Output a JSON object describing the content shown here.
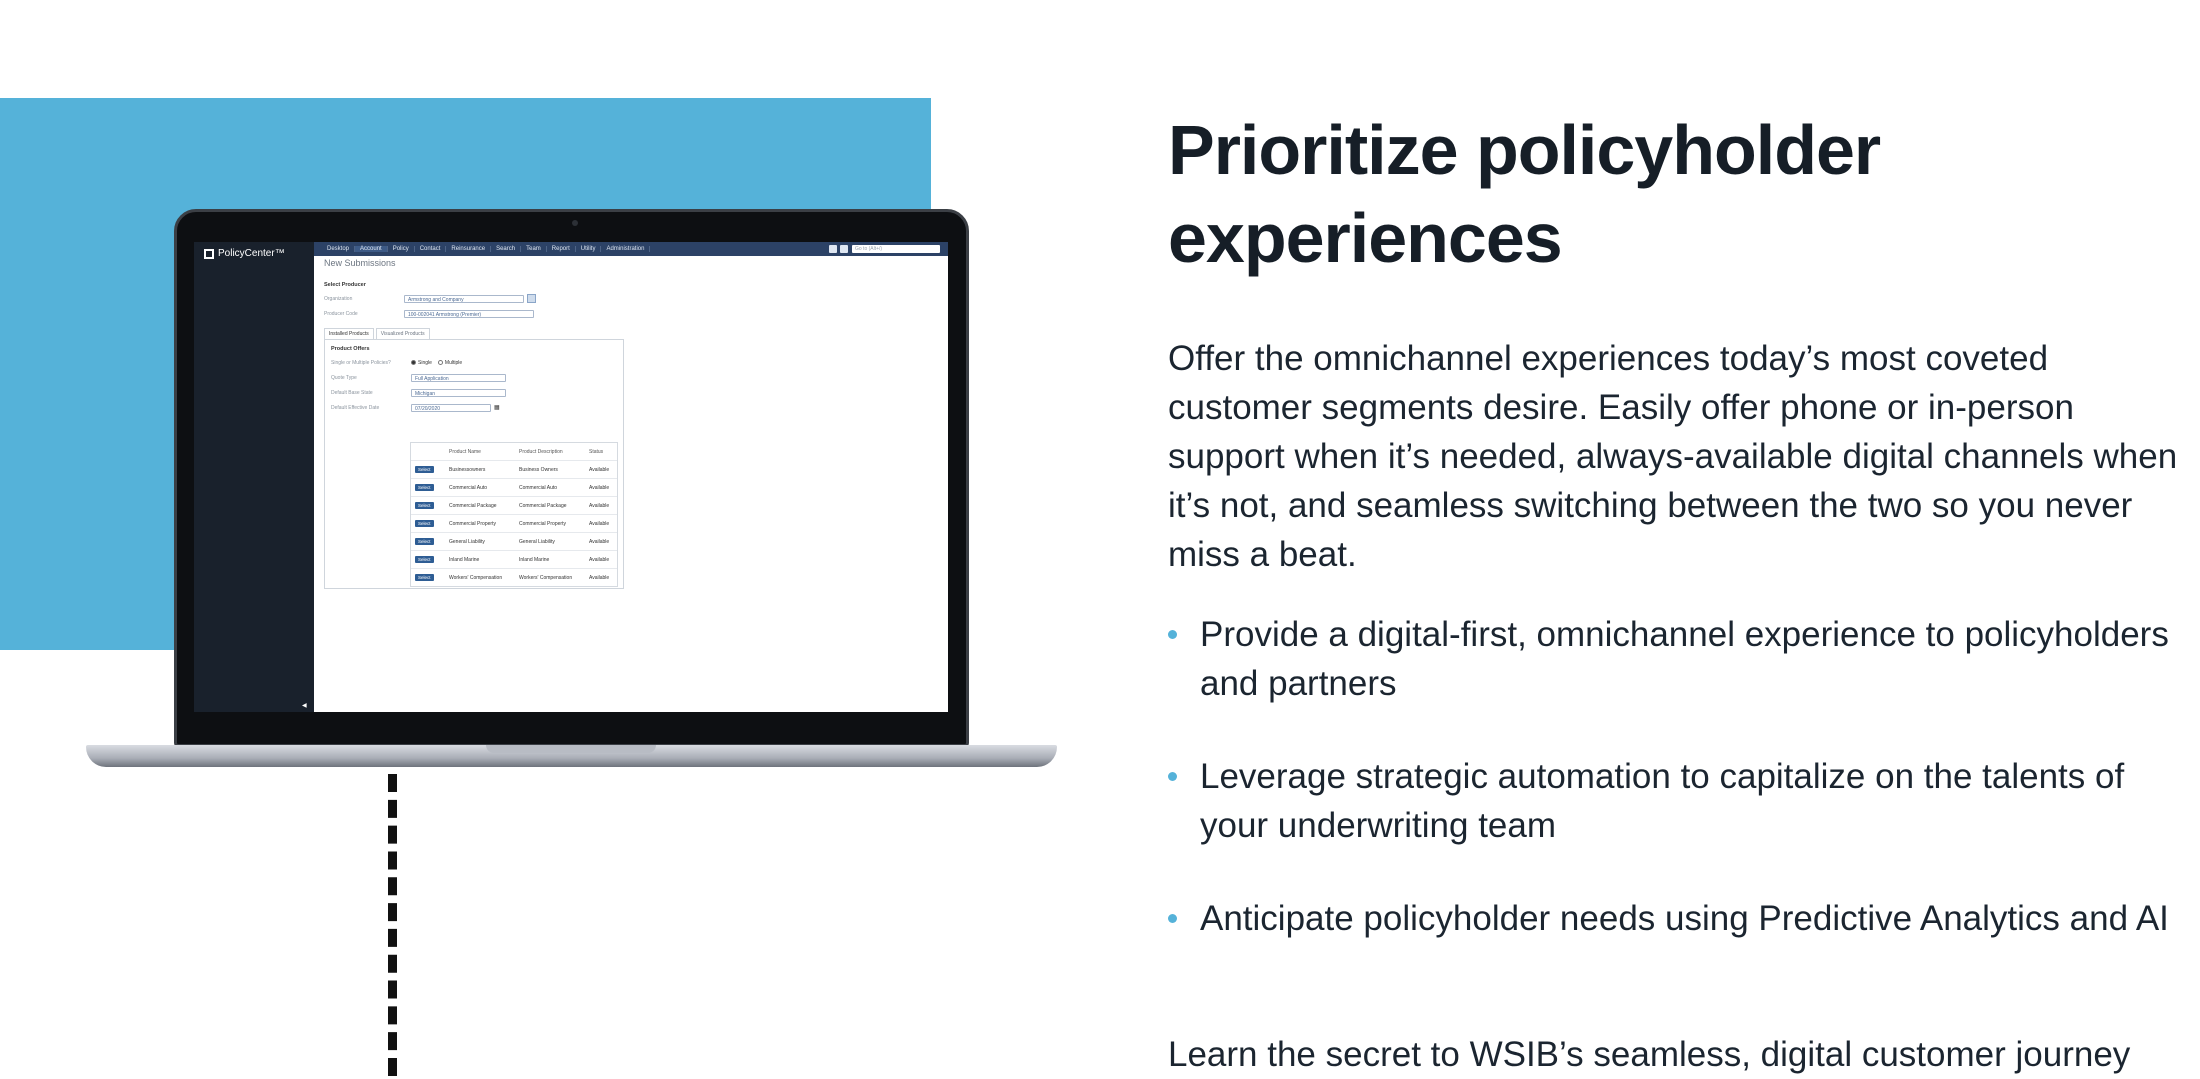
{
  "hero": {
    "heading": "Prioritize policyholder experiences",
    "intro": "Offer the omnichannel experiences today’s most coveted customer segments desire. Easily offer phone or in-person support when it’s needed, always-available digital channels when it’s not, and seamless switching between the two so you never miss a beat.",
    "bullets": [
      "Provide a digital-first, omnichannel experience to policyholders and partners",
      "Leverage strategic automation to capitalize on the talents of your underwriting team",
      "Anticipate policyholder needs using Predictive Analytics and AI"
    ],
    "cta": "Learn the secret to WSIB’s seamless, digital customer journey",
    "accent_color": "#55b2d9"
  },
  "app": {
    "logo": "PolicyCenter™",
    "nav": [
      "Desktop",
      "Account",
      "Policy",
      "Contact",
      "Reinsurance",
      "Search",
      "Team",
      "Report",
      "Utility",
      "Administration"
    ],
    "search_placeholder": "Go to (Alt+/)",
    "page_title": "New Submissions",
    "select_producer": "Select Producer",
    "organization_label": "Organization",
    "organization_value": "Armstrong and Company",
    "producer_code_label": "Producer Code",
    "producer_code_value": "100-002041 Armstrong (Premier)",
    "tabs": [
      "Installed Products",
      "Visualized Products"
    ],
    "product_offers": "Product Offers",
    "policy_type_label": "Single or Multiple Policies?",
    "single": "Single",
    "multiple": "Multiple",
    "quote_type_label": "Quote Type",
    "quote_type_value": "Full Application",
    "base_state_label": "Default Base State",
    "base_state_value": "Michigan",
    "effective_date_label": "Default Effective Date",
    "effective_date_value": "07/20/2020",
    "table_headers": [
      "Product Name",
      "Product Description",
      "Status"
    ],
    "select_label": "Select",
    "products": [
      {
        "name": "Businessowners",
        "desc": "Business Owners",
        "status": "Available"
      },
      {
        "name": "Commercial Auto",
        "desc": "Commercial Auto",
        "status": "Available"
      },
      {
        "name": "Commercial Package",
        "desc": "Commercial Package",
        "status": "Available"
      },
      {
        "name": "Commercial Property",
        "desc": "Commercial Property",
        "status": "Available"
      },
      {
        "name": "General Liability",
        "desc": "General Liability",
        "status": "Available"
      },
      {
        "name": "Inland Marine",
        "desc": "Inland Marine",
        "status": "Available"
      },
      {
        "name": "Workers' Compensation",
        "desc": "Workers' Compensation",
        "status": "Available"
      }
    ]
  }
}
